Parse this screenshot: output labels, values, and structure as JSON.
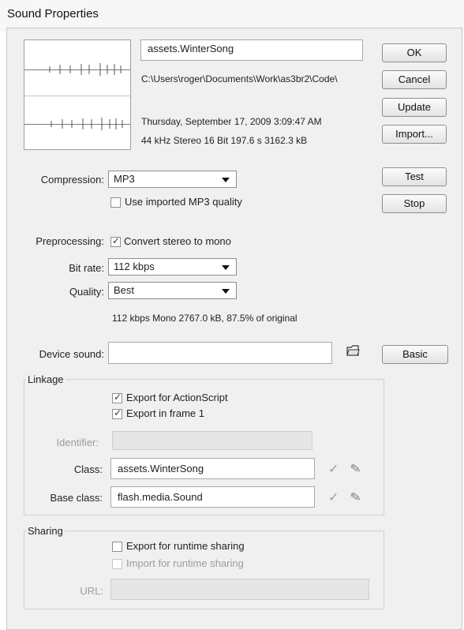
{
  "window": {
    "title": "Sound Properties"
  },
  "file": {
    "name": "assets.WinterSong",
    "path": "C:\\Users\\roger\\Documents\\Work\\as3br2\\Code\\",
    "date": "Thursday, September 17, 2009 3:09:47 AM",
    "info": "44 kHz Stereo 16 Bit 197.6 s 3162.3 kB"
  },
  "buttons": {
    "ok": "OK",
    "cancel": "Cancel",
    "update": "Update",
    "import": "Import...",
    "test": "Test",
    "stop": "Stop",
    "basic": "Basic"
  },
  "compression": {
    "label": "Compression:",
    "value": "MP3",
    "use_imported": "Use imported MP3 quality",
    "use_imported_checked": false
  },
  "preprocessing": {
    "label": "Preprocessing:",
    "option": "Convert stereo to mono",
    "checked": true
  },
  "bitrate": {
    "label": "Bit rate:",
    "value": "112 kbps"
  },
  "quality": {
    "label": "Quality:",
    "value": "Best"
  },
  "summary": "112 kbps  Mono 2767.0 kB, 87.5% of original",
  "device_sound": {
    "label": "Device sound:",
    "value": ""
  },
  "linkage": {
    "title": "Linkage",
    "export_actionscript": "Export for ActionScript",
    "export_actionscript_checked": true,
    "export_frame1": "Export in frame 1",
    "export_frame1_checked": true,
    "identifier_label": "Identifier:",
    "identifier_value": "",
    "class_label": "Class:",
    "class_value": "assets.WinterSong",
    "base_class_label": "Base class:",
    "base_class_value": "flash.media.Sound"
  },
  "sharing": {
    "title": "Sharing",
    "export_runtime": "Export for runtime sharing",
    "export_runtime_checked": false,
    "import_runtime": "Import for runtime sharing",
    "import_runtime_checked": false,
    "url_label": "URL:",
    "url_value": ""
  },
  "icons": {
    "folder": "folder-icon",
    "check": "check-icon",
    "pencil": "pencil-icon"
  }
}
